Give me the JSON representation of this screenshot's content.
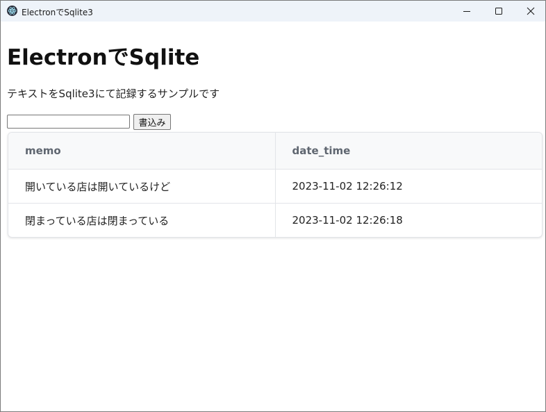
{
  "window": {
    "title": "ElectronでSqlite3",
    "icon": "electron-app-icon",
    "controls": [
      "minimize-icon",
      "maximize-icon",
      "close-icon"
    ]
  },
  "page": {
    "heading": "ElectronでSqlite",
    "description": "テキストをSqlite3にて記録するサンプルです"
  },
  "form": {
    "input_value": "",
    "button_label": "書込み"
  },
  "table": {
    "columns": [
      "memo",
      "date_time"
    ],
    "rows": [
      [
        "開いている店は開いているけど",
        "2023-11-02 12:26:12"
      ],
      [
        "閉まっている店は閉まっている",
        "2023-11-02 12:26:18"
      ]
    ]
  }
}
